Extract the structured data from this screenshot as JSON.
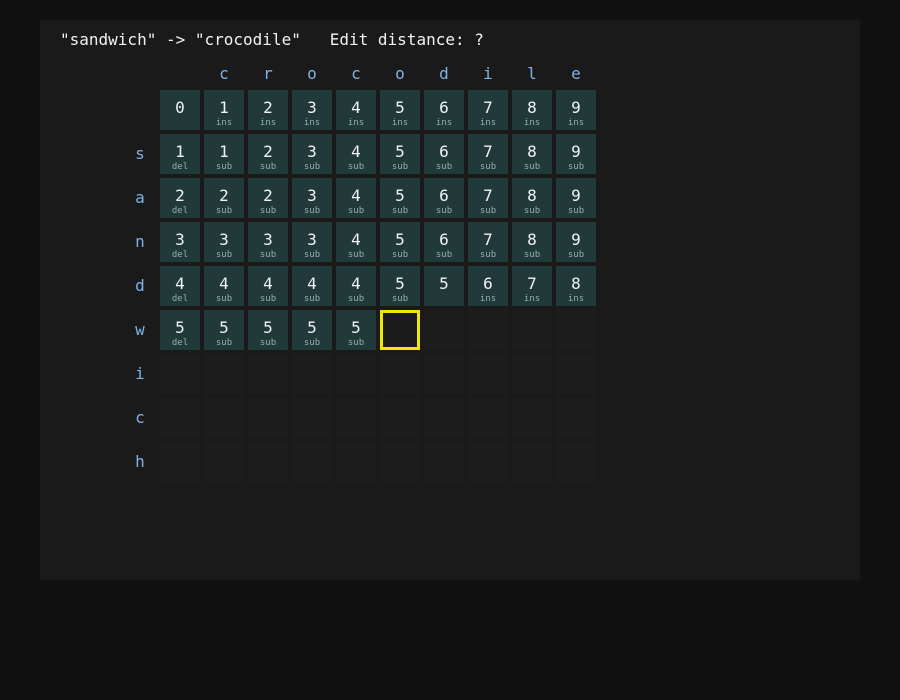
{
  "header": {
    "source": "\"sandwich\"",
    "arrow": "->",
    "target": "\"crocodile\"",
    "distance_label": "Edit distance:",
    "distance_value": "?"
  },
  "columns": [
    "",
    "c",
    "r",
    "o",
    "c",
    "o",
    "d",
    "i",
    "l",
    "e"
  ],
  "rows": [
    "",
    "s",
    "a",
    "n",
    "d",
    "w",
    "i",
    "c",
    "h"
  ],
  "grid": [
    [
      {
        "v": "0",
        "op": ""
      },
      {
        "v": "1",
        "op": "ins"
      },
      {
        "v": "2",
        "op": "ins"
      },
      {
        "v": "3",
        "op": "ins"
      },
      {
        "v": "4",
        "op": "ins"
      },
      {
        "v": "5",
        "op": "ins"
      },
      {
        "v": "6",
        "op": "ins"
      },
      {
        "v": "7",
        "op": "ins"
      },
      {
        "v": "8",
        "op": "ins"
      },
      {
        "v": "9",
        "op": "ins"
      }
    ],
    [
      {
        "v": "1",
        "op": "del"
      },
      {
        "v": "1",
        "op": "sub"
      },
      {
        "v": "2",
        "op": "sub"
      },
      {
        "v": "3",
        "op": "sub"
      },
      {
        "v": "4",
        "op": "sub"
      },
      {
        "v": "5",
        "op": "sub"
      },
      {
        "v": "6",
        "op": "sub"
      },
      {
        "v": "7",
        "op": "sub"
      },
      {
        "v": "8",
        "op": "sub"
      },
      {
        "v": "9",
        "op": "sub"
      }
    ],
    [
      {
        "v": "2",
        "op": "del"
      },
      {
        "v": "2",
        "op": "sub"
      },
      {
        "v": "2",
        "op": "sub"
      },
      {
        "v": "3",
        "op": "sub"
      },
      {
        "v": "4",
        "op": "sub"
      },
      {
        "v": "5",
        "op": "sub"
      },
      {
        "v": "6",
        "op": "sub"
      },
      {
        "v": "7",
        "op": "sub"
      },
      {
        "v": "8",
        "op": "sub"
      },
      {
        "v": "9",
        "op": "sub"
      }
    ],
    [
      {
        "v": "3",
        "op": "del"
      },
      {
        "v": "3",
        "op": "sub"
      },
      {
        "v": "3",
        "op": "sub"
      },
      {
        "v": "3",
        "op": "sub"
      },
      {
        "v": "4",
        "op": "sub"
      },
      {
        "v": "5",
        "op": "sub"
      },
      {
        "v": "6",
        "op": "sub"
      },
      {
        "v": "7",
        "op": "sub"
      },
      {
        "v": "8",
        "op": "sub"
      },
      {
        "v": "9",
        "op": "sub"
      }
    ],
    [
      {
        "v": "4",
        "op": "del"
      },
      {
        "v": "4",
        "op": "sub"
      },
      {
        "v": "4",
        "op": "sub"
      },
      {
        "v": "4",
        "op": "sub"
      },
      {
        "v": "4",
        "op": "sub"
      },
      {
        "v": "5",
        "op": "sub"
      },
      {
        "v": "5",
        "op": ""
      },
      {
        "v": "6",
        "op": "ins"
      },
      {
        "v": "7",
        "op": "ins"
      },
      {
        "v": "8",
        "op": "ins"
      }
    ],
    [
      {
        "v": "5",
        "op": "del"
      },
      {
        "v": "5",
        "op": "sub"
      },
      {
        "v": "5",
        "op": "sub"
      },
      {
        "v": "5",
        "op": "sub"
      },
      {
        "v": "5",
        "op": "sub"
      },
      null,
      null,
      null,
      null,
      null
    ],
    [
      null,
      null,
      null,
      null,
      null,
      null,
      null,
      null,
      null,
      null
    ],
    [
      null,
      null,
      null,
      null,
      null,
      null,
      null,
      null,
      null,
      null
    ],
    [
      null,
      null,
      null,
      null,
      null,
      null,
      null,
      null,
      null,
      null
    ]
  ],
  "current_cell": {
    "row": 5,
    "col": 5
  },
  "colors": {
    "filled_cell": "#22393a",
    "empty_cell": "#1d1d1d",
    "highlight": "#f3e600",
    "label": "#7fb3e6"
  }
}
